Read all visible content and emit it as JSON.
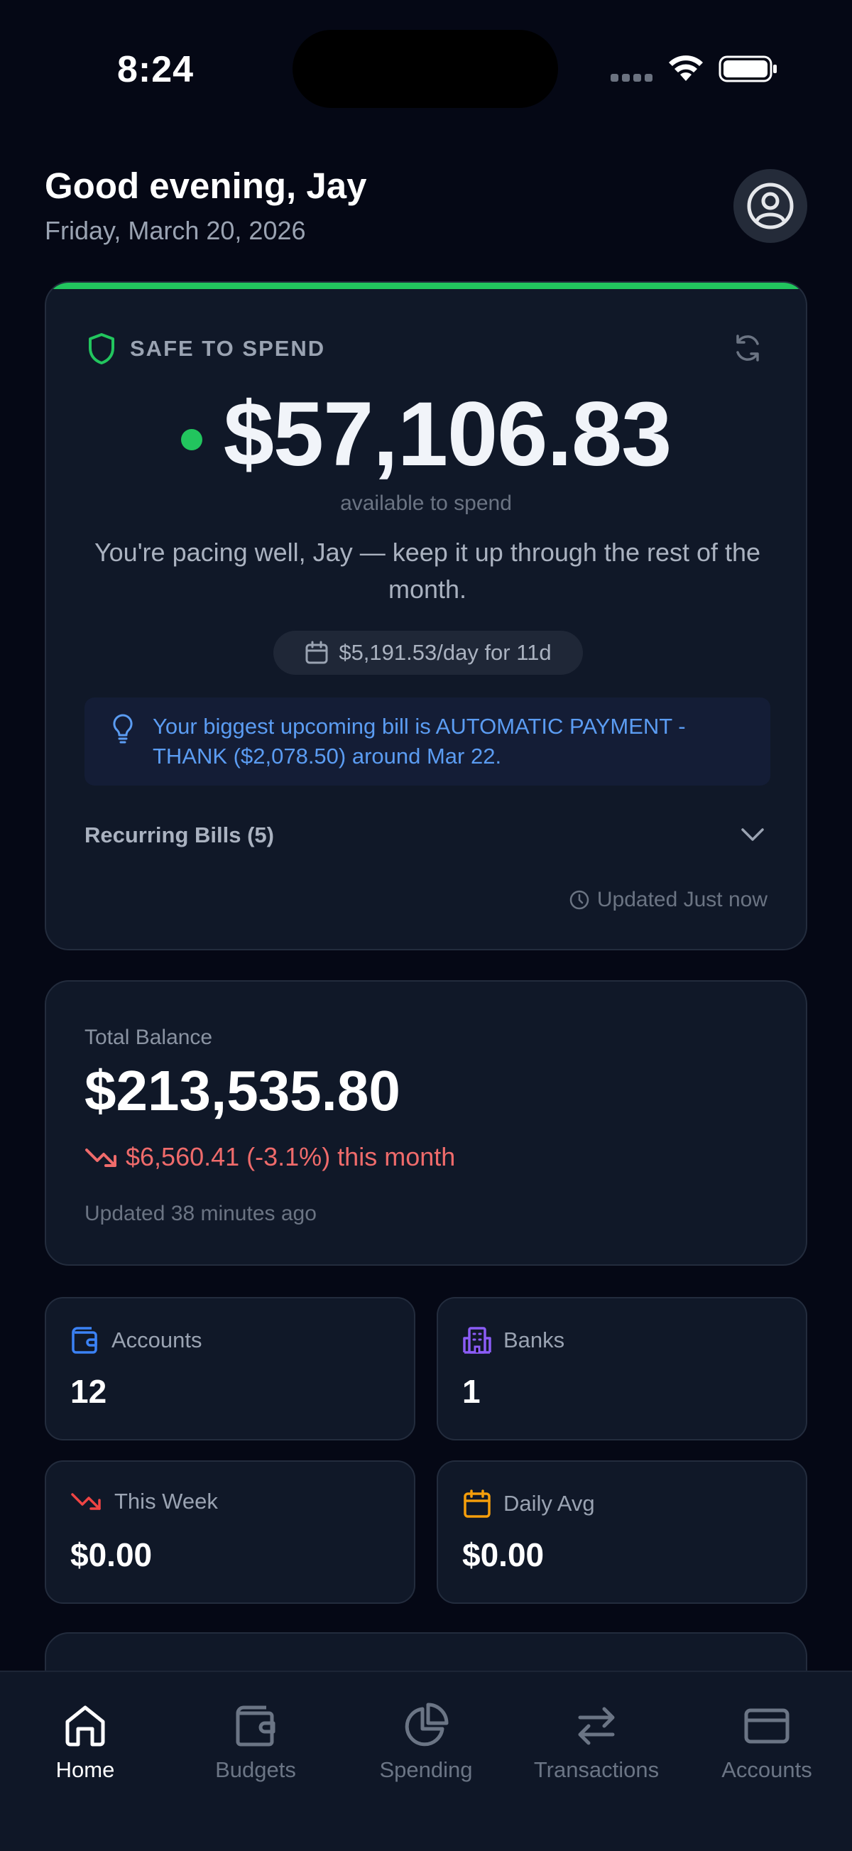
{
  "status_bar": {
    "time": "8:24"
  },
  "header": {
    "greeting": "Good evening, Jay",
    "date": "Friday, March 20, 2026"
  },
  "safe_to_spend": {
    "label": "SAFE TO SPEND",
    "amount": "$57,106.83",
    "sublabel": "available to spend",
    "message": "You're pacing well, Jay — keep it up through the rest of the month.",
    "per_day": "$5,191.53/day for 11d",
    "tip": "Your biggest upcoming bill is AUTOMATIC PAYMENT - THANK ($2,078.50) around Mar 22.",
    "recurring_bills": "Recurring Bills (5)",
    "updated": "Updated Just now",
    "accent_color": "#22c55e"
  },
  "total_balance": {
    "label": "Total Balance",
    "amount": "$213,535.80",
    "change": "$6,560.41 (-3.1%) this month",
    "updated": "Updated 38 minutes ago",
    "change_color": "#ef6b6b"
  },
  "stats": [
    {
      "icon": "wallet-icon",
      "label": "Accounts",
      "value": "12"
    },
    {
      "icon": "building-icon",
      "label": "Banks",
      "value": "1"
    },
    {
      "icon": "trending-down-icon",
      "label": "This Week",
      "value": "$0.00"
    },
    {
      "icon": "calendar-icon",
      "label": "Daily Avg",
      "value": "$0.00"
    }
  ],
  "nav": [
    {
      "icon": "home-icon",
      "label": "Home",
      "active": true
    },
    {
      "icon": "wallet-icon",
      "label": "Budgets",
      "active": false
    },
    {
      "icon": "pie-chart-icon",
      "label": "Spending",
      "active": false
    },
    {
      "icon": "arrows-left-right-icon",
      "label": "Transactions",
      "active": false
    },
    {
      "icon": "credit-card-icon",
      "label": "Accounts",
      "active": false
    }
  ]
}
